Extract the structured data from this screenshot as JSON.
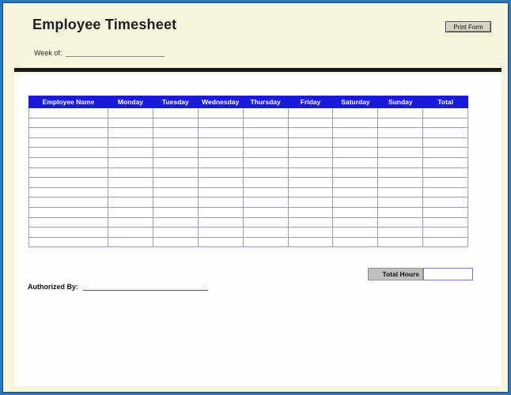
{
  "header": {
    "title": "Employee Timesheet",
    "print_button_label": "Print Form",
    "week_of_label": "Week of:",
    "week_of_value": ""
  },
  "table": {
    "columns": [
      "Employee Name",
      "Monday",
      "Tuesday",
      "Wednesday",
      "Thursday",
      "Friday",
      "Saturday",
      "Sunday",
      "Total"
    ],
    "row_count": 14,
    "cell_value": ""
  },
  "footer": {
    "total_hours_label": "Total Hours",
    "total_hours_value": "",
    "authorized_by_label": "Authorized By:",
    "authorized_by_value": ""
  },
  "colors": {
    "page_background": "#f7f4dd",
    "page_border": "#2b79b9",
    "page_border_inner": "#16466e",
    "sheet_background": "#fdfdfb",
    "table_header_background": "#1a1ad9",
    "table_header_text": "#ffffff",
    "table_grid": "#9b9bb0",
    "separator": "#1a1a1a",
    "button_face": "#d6d2c4",
    "total_hours_box": "#c0c0c0",
    "total_input_border": "#7878c8"
  }
}
